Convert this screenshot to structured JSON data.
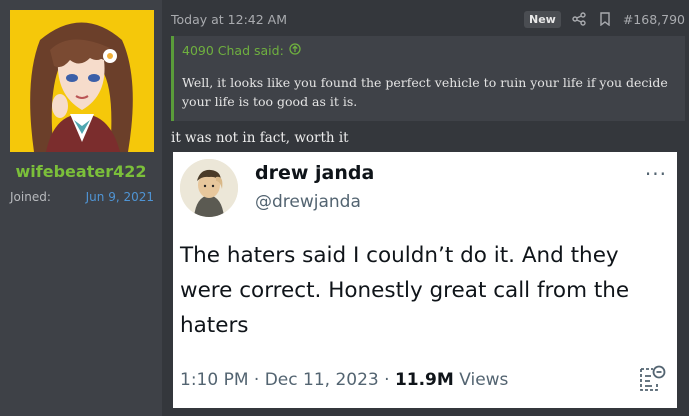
{
  "user": {
    "username": "wifebeater422",
    "joined_label": "Joined:",
    "joined_value": "Jun 9, 2021"
  },
  "post": {
    "time": "Today at 12:42 AM",
    "new_badge": "New",
    "post_number": "#168,790",
    "quote": {
      "author": "4090 Chad said:",
      "text": "Well, it looks like you found the perfect vehicle to ruin your life if you decide your life is too good as it is."
    },
    "text": "it was not in fact, worth it"
  },
  "tweet": {
    "name": "drew janda",
    "handle": "@drewjanda",
    "text": "The haters said I couldn’t do it. And they were correct. Honestly great call from the haters",
    "date": "1:10 PM · Dec 11, 2023 · ",
    "views": "11.9M",
    "views_label": " Views",
    "more": "···"
  },
  "colors": {
    "username": "#7bbf3a",
    "joined": "#4f94d4",
    "quote_accent": "#6fb03f"
  }
}
